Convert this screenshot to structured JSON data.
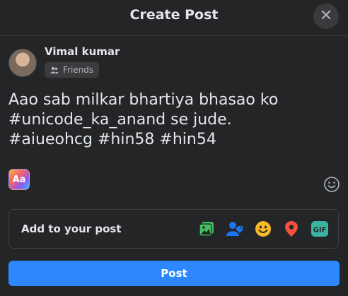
{
  "dialog": {
    "title": "Create Post"
  },
  "user": {
    "name": "Vimal kumar",
    "audience": "Friends"
  },
  "composer": {
    "text": "Aao sab milkar bhartiya bhasao ko\n#unicode_ka_anand se jude.\n#aiueohcg #hin58 #hin54"
  },
  "add_to_post": {
    "label": "Add to your post",
    "tools": [
      "photo-video-icon",
      "tag-people-icon",
      "feeling-icon",
      "check-in-icon",
      "gif-icon"
    ]
  },
  "post_button": {
    "label": "Post"
  },
  "colors": {
    "background": "#242526",
    "accent": "#2d88ff",
    "green": "#45bd62",
    "blue": "#1877f2",
    "yellow": "#f7b928",
    "red": "#f5533d",
    "teal": "#3bb4a0"
  }
}
